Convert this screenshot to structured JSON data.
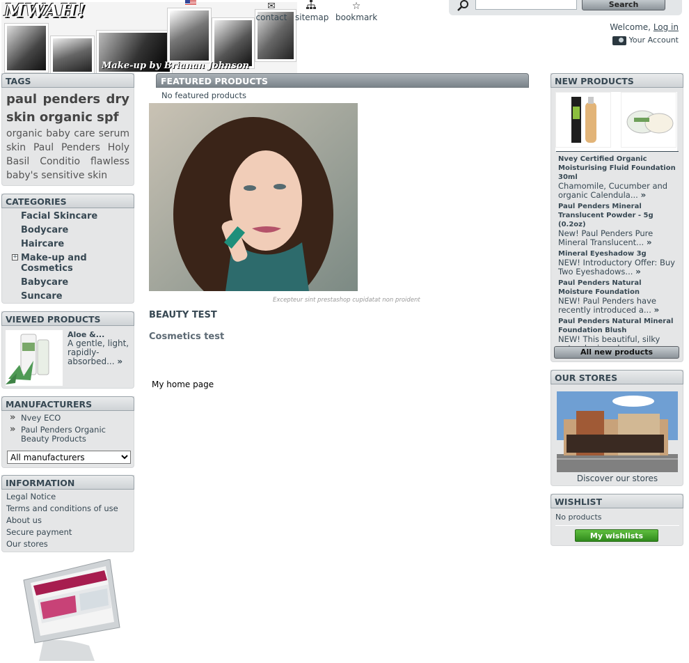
{
  "header": {
    "banner_title": "MWAH!",
    "banner_subtitle": "Make-up by Brianan Johnson",
    "links": [
      {
        "label": "contact",
        "icon": "contact-icon"
      },
      {
        "label": "sitemap",
        "icon": "sitemap-icon"
      },
      {
        "label": "bookmark",
        "icon": "bookmark-star-icon"
      }
    ],
    "search": {
      "placeholder": "",
      "button_label": "Search"
    },
    "welcome_text": "Welcome,",
    "login_link": "Log in",
    "account_link": "Your Account"
  },
  "tags": {
    "title": "TAGS",
    "large": "paul penders dry skin organic spf",
    "small": "organic baby care serum skin Paul Penders Holy Basil Conditio flawless baby's sensitive skin"
  },
  "categories": {
    "title": "CATEGORIES",
    "items": [
      {
        "label": "Facial Skincare",
        "expandable": false
      },
      {
        "label": "Bodycare",
        "expandable": false
      },
      {
        "label": "Haircare",
        "expandable": false
      },
      {
        "label": "Make-up and Cosmetics",
        "expandable": true
      },
      {
        "label": "Babycare",
        "expandable": false
      },
      {
        "label": "Suncare",
        "expandable": false
      }
    ]
  },
  "viewed": {
    "title": "VIEWED PRODUCTS",
    "product_name": "Aloe &...",
    "product_desc": "A gentle, light, rapidly-absorbed...",
    "more": "»"
  },
  "manufacturers": {
    "title": "MANUFACTURERS",
    "items": [
      "Nvey ECO",
      "Paul Penders Organic Beauty Products"
    ],
    "select_value": "All manufacturers"
  },
  "information": {
    "title": "INFORMATION",
    "items": [
      "Legal Notice",
      "Terms and conditions of use",
      "About us",
      "Secure payment",
      "Our stores"
    ]
  },
  "featured": {
    "title": "FEATURED PRODUCTS",
    "empty_text": "No featured products",
    "caption": "Excepteur sint prestashop cupidatat non proident",
    "heading": "BEAUTY TEST",
    "subheading": "Cosmetics test",
    "footer_text": "My home page"
  },
  "new_products": {
    "title": "NEW PRODUCTS",
    "items": [
      {
        "name": "Nvey Certified Organic Moisturising Fluid Foundation 30ml",
        "desc": "Chamomile, Cucumber and organic Calendula..."
      },
      {
        "name": "Paul Penders Mineral Translucent Powder - 5g (0.2oz)",
        "desc": "New!  Paul Penders Pure Mineral Translucent..."
      },
      {
        "name": "Mineral Eyeshadow 3g",
        "desc": "NEW!  Introductory Offer: Buy Two Eyeshadows..."
      },
      {
        "name": "Paul Penders Natural Moisture Foundation",
        "desc": "NEW!  Paul Penders have recently introduced a..."
      },
      {
        "name": "Paul Penders Natural Mineral Foundation Blush",
        "desc": "NEW!  This beautiful, silky natural mineral..."
      }
    ],
    "more": "»",
    "all_button": "All new products"
  },
  "stores": {
    "title": "OUR STORES",
    "caption": "Discover our stores"
  },
  "wishlist": {
    "title": "WISHLIST",
    "empty_text": "No products",
    "button": "My wishlists"
  },
  "colors": {
    "text": "#374853",
    "block_bg": "#e5e6e7",
    "featured_header": "#8a9298",
    "wishlist_button": "#3f9f2a"
  }
}
